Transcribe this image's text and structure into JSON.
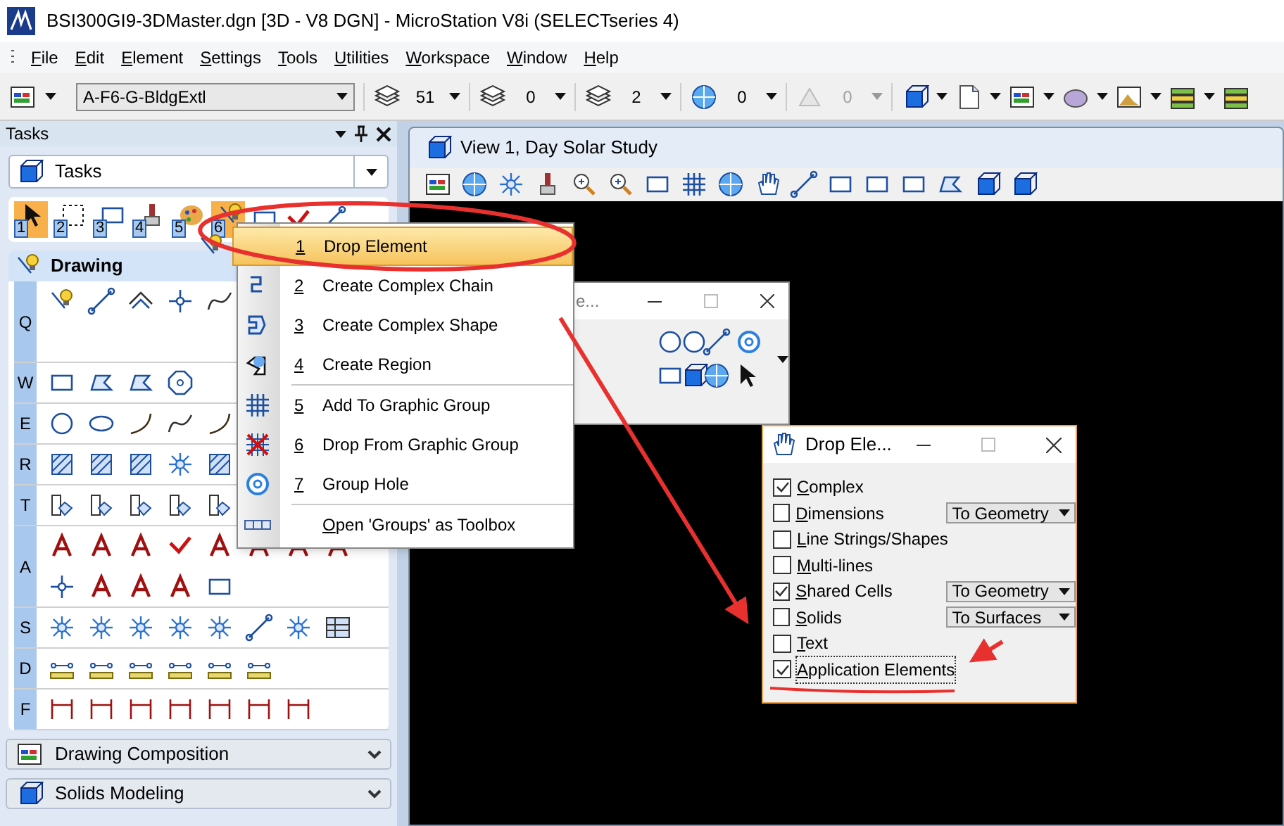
{
  "window": {
    "title": "BSI300GI9-3DMaster.dgn [3D - V8 DGN] - MicroStation V8i (SELECTseries 4)"
  },
  "menu_bar": [
    "File",
    "Edit",
    "Element",
    "Settings",
    "Tools",
    "Utilities",
    "Workspace",
    "Window",
    "Help"
  ],
  "attributes_toolbar": {
    "level": "A-F6-G-BldgExtl",
    "fields": [
      {
        "value": "51",
        "disabled": false
      },
      {
        "value": "0",
        "disabled": false
      },
      {
        "value": "2",
        "disabled": false
      },
      {
        "value": "0",
        "disabled": false
      },
      {
        "value": "0",
        "disabled": true
      }
    ]
  },
  "tasks_panel": {
    "title": "Tasks",
    "task_selector": "Tasks",
    "task_buttons": [
      {
        "label": "1",
        "selected": true
      },
      {
        "label": "2",
        "selected": false
      },
      {
        "label": "3",
        "selected": false
      },
      {
        "label": "4",
        "selected": false
      },
      {
        "label": "5",
        "selected": false
      },
      {
        "label": "6",
        "selected": true
      }
    ],
    "drawing_section": {
      "title": "Drawing",
      "rows": [
        {
          "key": "Q"
        },
        {
          "key": "W"
        },
        {
          "key": "E"
        },
        {
          "key": "R"
        },
        {
          "key": "T"
        },
        {
          "key": "A"
        },
        {
          "key": "S"
        },
        {
          "key": "D"
        },
        {
          "key": "F"
        }
      ]
    },
    "collapsed_sections": [
      "Drawing Composition",
      "Solids Modeling"
    ]
  },
  "view_window": {
    "title": "View 1, Day Solar Study"
  },
  "popup_menu": {
    "groups": [
      [
        {
          "number": "1",
          "label": "Drop Element",
          "selected": true
        },
        {
          "number": "2",
          "label": "Create Complex Chain",
          "selected": false
        },
        {
          "number": "3",
          "label": "Create Complex Shape",
          "selected": false
        },
        {
          "number": "4",
          "label": "Create Region",
          "selected": false
        }
      ],
      [
        {
          "number": "5",
          "label": "Add To Graphic Group",
          "selected": false
        },
        {
          "number": "6",
          "label": "Drop From Graphic Group",
          "selected": false
        },
        {
          "number": "7",
          "label": "Group Hole",
          "selected": false
        }
      ],
      [
        {
          "label": "Open 'Groups' as Toolbox",
          "selected": false
        }
      ]
    ]
  },
  "toolbox_window": {
    "title": "e..."
  },
  "drop_element_dialog": {
    "title": "Drop Ele...",
    "options": [
      {
        "label": "Complex",
        "checked": true,
        "focused": false
      },
      {
        "label": "Dimensions",
        "checked": false,
        "focused": false,
        "mode": "To Geometry"
      },
      {
        "label": "Line Strings/Shapes",
        "checked": false,
        "focused": false
      },
      {
        "label": "Multi-lines",
        "checked": false,
        "focused": false
      },
      {
        "label": "Shared Cells",
        "checked": true,
        "focused": false,
        "mode": "To Geometry"
      },
      {
        "label": "Solids",
        "checked": false,
        "focused": false,
        "mode": "To Surfaces"
      },
      {
        "label": "Text",
        "checked": false,
        "focused": false
      },
      {
        "label": "Application Elements",
        "checked": true,
        "focused": true
      }
    ]
  }
}
